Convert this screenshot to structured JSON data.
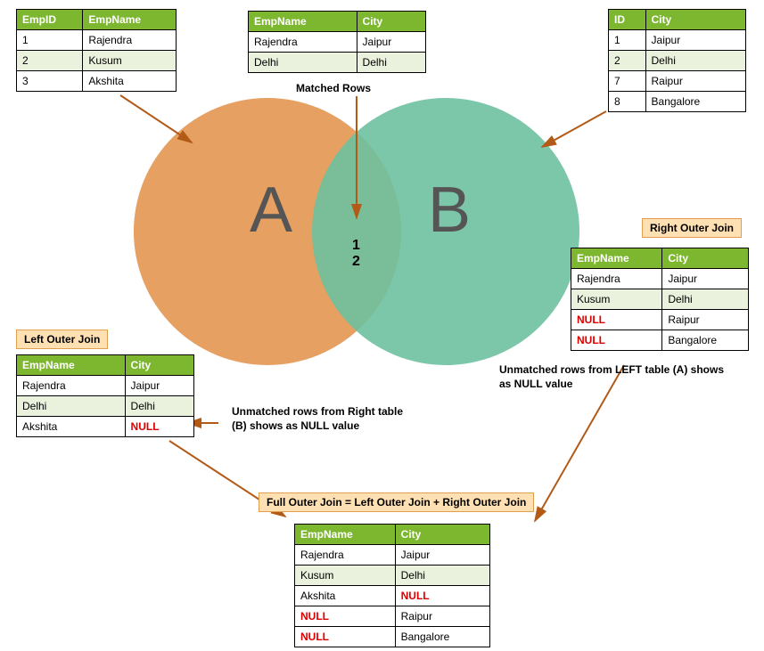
{
  "colors": {
    "header": "#7db72f",
    "circleA": "#e49b5a",
    "circleB": "#6ec0a0",
    "arrow": "#b35a17"
  },
  "venn": {
    "A": "A",
    "B": "B",
    "inter1": "1",
    "inter2": "2"
  },
  "captions": {
    "matched": "Matched Rows",
    "leftJoin": "Left Outer Join",
    "rightJoin": "Right Outer Join",
    "fullJoin": "Full Outer Join = Left Outer Join + Right Outer Join",
    "noteLeft": "Unmatched rows from Right table (B) shows as NULL value",
    "noteRight": "Unmatched rows from LEFT table (A) shows as NULL value"
  },
  "tableA": {
    "headers": [
      "EmpID",
      "EmpName"
    ],
    "rows": [
      [
        "1",
        "Rajendra"
      ],
      [
        "2",
        "Kusum"
      ],
      [
        "3",
        "Akshita"
      ]
    ]
  },
  "tableMatched": {
    "headers": [
      "EmpName",
      "City"
    ],
    "rows": [
      [
        "Rajendra",
        "Jaipur"
      ],
      [
        "Delhi",
        "Delhi"
      ]
    ]
  },
  "tableB": {
    "headers": [
      "ID",
      "City"
    ],
    "rows": [
      [
        "1",
        "Jaipur"
      ],
      [
        "2",
        "Delhi"
      ],
      [
        "7",
        "Raipur"
      ],
      [
        "8",
        "Bangalore"
      ]
    ]
  },
  "tableLeft": {
    "headers": [
      "EmpName",
      "City"
    ],
    "rows": [
      [
        "Rajendra",
        "Jaipur"
      ],
      [
        "Delhi",
        "Delhi"
      ],
      [
        "Akshita",
        "NULL"
      ]
    ]
  },
  "tableRight": {
    "headers": [
      "EmpName",
      "City"
    ],
    "rows": [
      [
        "Rajendra",
        "Jaipur"
      ],
      [
        "Kusum",
        "Delhi"
      ],
      [
        "NULL",
        "Raipur"
      ],
      [
        "NULL",
        "Bangalore"
      ]
    ]
  },
  "tableFull": {
    "headers": [
      "EmpName",
      "City"
    ],
    "rows": [
      [
        "Rajendra",
        "Jaipur"
      ],
      [
        "Kusum",
        "Delhi"
      ],
      [
        "Akshita",
        "NULL"
      ],
      [
        "NULL",
        "Raipur"
      ],
      [
        "NULL",
        "Bangalore"
      ]
    ]
  }
}
